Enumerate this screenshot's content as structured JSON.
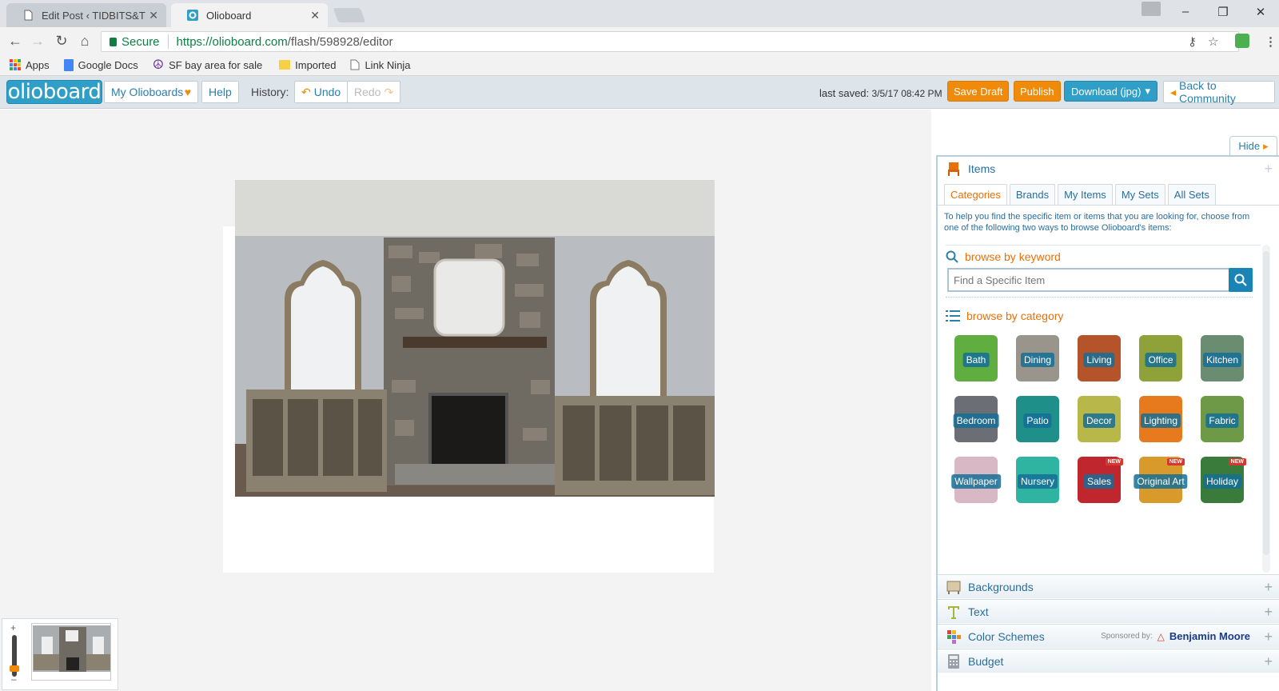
{
  "browser": {
    "tabs": [
      {
        "title": "Edit Post ‹ TIDBITS&TWI",
        "active": false
      },
      {
        "title": "Olioboard",
        "active": true
      }
    ],
    "address": {
      "secure_label": "Secure",
      "url_host": "https://olioboard.com",
      "url_path": "/flash/598928/editor"
    },
    "bookmarks": [
      {
        "label": "Apps",
        "icon": "apps-grid-icon"
      },
      {
        "label": "Google Docs",
        "icon": "google-docs-icon"
      },
      {
        "label": "SF bay area for sale \"c",
        "icon": "peace-icon"
      },
      {
        "label": "Imported",
        "icon": "folder-icon"
      },
      {
        "label": "Link Ninja",
        "icon": "page-icon"
      }
    ]
  },
  "app": {
    "logo": "olioboard",
    "my_olioboards": "My Olioboards",
    "help": "Help",
    "history_label": "History:",
    "undo": "Undo",
    "redo": "Redo",
    "last_saved_label": "last saved:",
    "last_saved_value": "3/5/17 08:42 PM",
    "save_draft": "Save Draft",
    "publish": "Publish",
    "download": "Download (jpg)",
    "back": "Back to Community"
  },
  "panel": {
    "hide": "Hide",
    "items_title": "Items",
    "subtabs": [
      "Categories",
      "Brands",
      "My Items",
      "My Sets",
      "All Sets"
    ],
    "active_subtab": "Categories",
    "help_text": "To help you find the specific item or items that you are looking for, choose from one of the following two ways to browse Olioboard's items:",
    "browse_keyword": "browse by keyword",
    "search_placeholder": "Find a Specific Item",
    "browse_category": "browse by category",
    "categories": [
      {
        "label": "Bath",
        "color": "#5fae3f",
        "new": false
      },
      {
        "label": "Dining",
        "color": "#9a958c",
        "new": false
      },
      {
        "label": "Living",
        "color": "#b5542a",
        "new": false
      },
      {
        "label": "Office",
        "color": "#8fa23a",
        "new": false
      },
      {
        "label": "Kitchen",
        "color": "#6a8c70",
        "new": false
      },
      {
        "label": "Bedroom",
        "color": "#6b6f75",
        "new": false
      },
      {
        "label": "Patio",
        "color": "#1f8f8a",
        "new": false
      },
      {
        "label": "Decor",
        "color": "#b8b84a",
        "new": false
      },
      {
        "label": "Lighting",
        "color": "#e87a1e",
        "new": false
      },
      {
        "label": "Fabric",
        "color": "#6e9a48",
        "new": false
      },
      {
        "label": "Wallpaper",
        "color": "#d9b8c6",
        "new": false
      },
      {
        "label": "Nursery",
        "color": "#2fb4a2",
        "new": false
      },
      {
        "label": "Sales",
        "color": "#c0262e",
        "new": true
      },
      {
        "label": "Original Art",
        "color": "#d89a2a",
        "new": true
      },
      {
        "label": "Holiday",
        "color": "#3a7a3a",
        "new": true
      }
    ],
    "new_tag": "NEW",
    "sections": [
      {
        "label": "Backgrounds",
        "icon": "backgrounds-icon"
      },
      {
        "label": "Text",
        "icon": "text-icon"
      },
      {
        "label": "Color Schemes",
        "icon": "color-schemes-icon"
      },
      {
        "label": "Budget",
        "icon": "budget-icon"
      }
    ],
    "sponsor_label": "Sponsored by:",
    "sponsor_brand": "Benjamin Moore"
  },
  "colors": {
    "accent_orange": "#f08a0a",
    "accent_blue": "#2f9fc7",
    "link_blue": "#2b7fab"
  }
}
